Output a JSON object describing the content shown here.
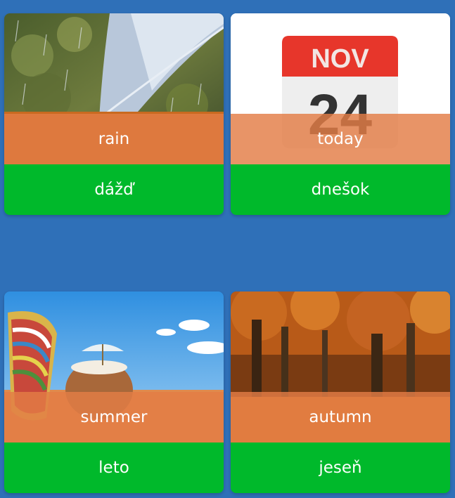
{
  "cards": [
    {
      "prompt": "rain",
      "answer": "dážď",
      "image_icon": "rain-umbrella-photo"
    },
    {
      "prompt": "today",
      "answer": "dnešok",
      "image_icon": "calendar-icon",
      "calendar_month": "NOV",
      "calendar_day": "24"
    },
    {
      "prompt": "summer",
      "answer": "leto",
      "image_icon": "beach-photo"
    },
    {
      "prompt": "autumn",
      "answer": "jeseň",
      "image_icon": "autumn-forest-photo"
    }
  ],
  "colors": {
    "background": "#2f70b8",
    "overlay": "#e37d46",
    "answer_bar": "#00b92b",
    "calendar_red": "#e7362b"
  }
}
